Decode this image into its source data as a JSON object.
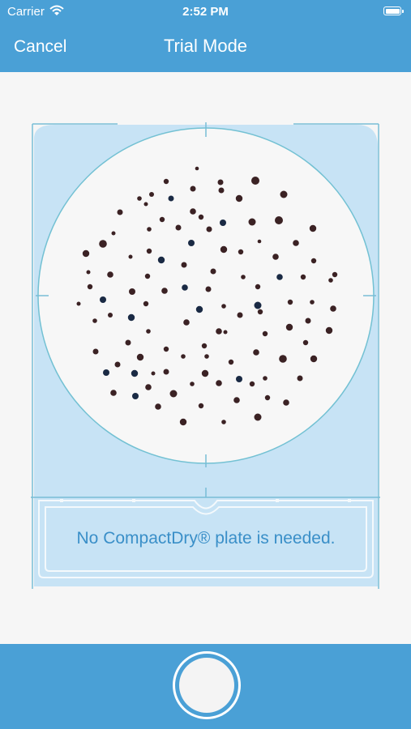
{
  "status_bar": {
    "carrier": "Carrier",
    "time": "2:52 PM"
  },
  "nav": {
    "cancel_label": "Cancel",
    "title": "Trial Mode"
  },
  "hint": {
    "text": "No CompactDry® plate is needed."
  },
  "colors": {
    "brand_blue": "#4aa0d6",
    "frame_fill": "#c7e3f5",
    "frame_line": "#6ec2d9",
    "hint_text": "#3a8fc8"
  },
  "icons": [
    "wifi-icon",
    "battery-icon",
    "shutter-button"
  ]
}
